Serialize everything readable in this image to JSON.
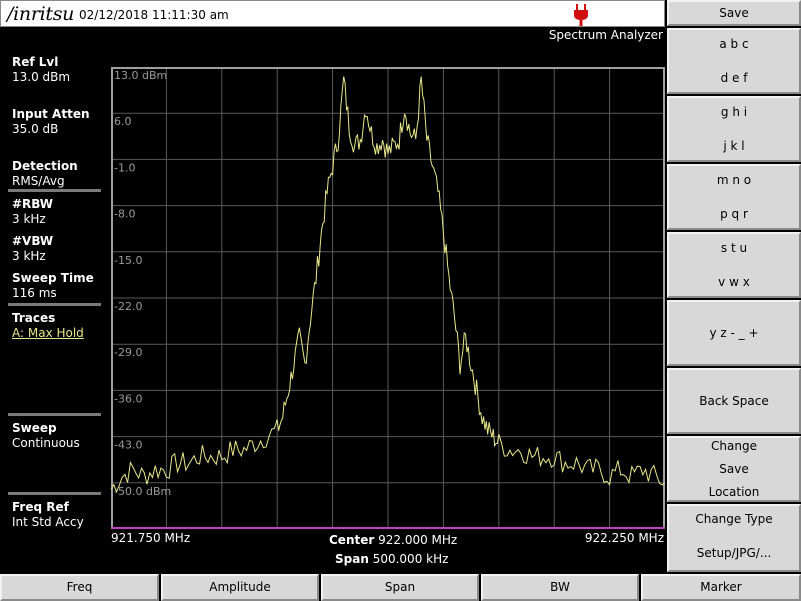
{
  "header": {
    "logo": "/inritsu",
    "datetime": "02/12/2018 11:11:30 am",
    "mode": "Spectrum Analyzer"
  },
  "left_panel": {
    "ref_lvl_label": "Ref Lvl",
    "ref_lvl_value": "13.0 dBm",
    "input_atten_label": "Input Atten",
    "input_atten_value": "35.0 dB",
    "detection_label": "Detection",
    "detection_value": "RMS/Avg",
    "rbw_label": "#RBW",
    "rbw_value": "3 kHz",
    "vbw_label": "#VBW",
    "vbw_value": "3 kHz",
    "sweep_time_label": "Sweep Time",
    "sweep_time_value": "116 ms",
    "traces_label": "Traces",
    "traces_value": "A: Max Hold",
    "sweep_label": "Sweep",
    "sweep_value": "Continuous",
    "freq_ref_label": "Freq Ref",
    "freq_ref_value": "Int Std Accy"
  },
  "graph": {
    "y_labels": [
      "13.0 dBm",
      "6.0",
      "-1.0",
      "-8.0",
      "-15.0",
      "-22.0",
      "-29.0",
      "-36.0",
      "-43.0",
      "-50.0 dBm"
    ],
    "x_start": "921.750 MHz",
    "x_end": "922.250 MHz",
    "center_label": "Center",
    "center_value": "922.000 MHz",
    "span_label": "Span",
    "span_value": "500.000 kHz",
    "colors": {
      "trace": "#e8e88a",
      "grid": "#5a5a5a",
      "frame": "#a0a0a0",
      "bottom_line": "#c040c0"
    }
  },
  "chart_data": {
    "type": "line",
    "title": "",
    "xlabel": "",
    "ylabel": "",
    "xlim": [
      921.75,
      922.25
    ],
    "ylim": [
      -57.0,
      13.0
    ],
    "x_unit": "MHz",
    "y_unit": "dBm",
    "grid": true,
    "series": [
      {
        "x": [
          921.75,
          921.76,
          921.77,
          921.78,
          921.79,
          921.8,
          921.81,
          921.82,
          921.83,
          921.84,
          921.85,
          921.86,
          921.87,
          921.88,
          921.89,
          921.9,
          921.905,
          921.91,
          921.915,
          921.92,
          921.925,
          921.93,
          921.935,
          921.94,
          921.945,
          921.95,
          921.955,
          921.96,
          921.965,
          921.97,
          921.975,
          921.98,
          921.985,
          921.99,
          921.995,
          922.0,
          922.005,
          922.01,
          922.015,
          922.02,
          922.025,
          922.03,
          922.035,
          922.04,
          922.045,
          922.05,
          922.055,
          922.06,
          922.065,
          922.07,
          922.075,
          922.08,
          922.085,
          922.09,
          922.095,
          922.1,
          922.11,
          922.12,
          922.13,
          922.14,
          922.15,
          922.16,
          922.17,
          922.18,
          922.19,
          922.2,
          922.21,
          922.22,
          922.23,
          922.24,
          922.25
        ],
        "y": [
          -51,
          -49,
          -48,
          -49,
          -48,
          -48,
          -47,
          -47,
          -46,
          -46,
          -46,
          -45,
          -45,
          -44,
          -43,
          -42,
          -40,
          -36,
          -32,
          -28,
          -32,
          -25,
          -19,
          -12,
          -6,
          -2,
          2,
          11,
          4,
          1,
          2,
          7,
          3,
          1,
          2,
          0,
          1,
          2,
          7,
          3,
          2,
          11,
          2,
          -2,
          -6,
          -12,
          -19,
          -25,
          -32,
          -28,
          -32,
          -36,
          -40,
          -42,
          -43,
          -44,
          -45,
          -45,
          -46,
          -46,
          -46,
          -47,
          -47,
          -48,
          -48,
          -49,
          -48,
          -49,
          -48,
          -49,
          -50
        ]
      }
    ]
  },
  "softkeys": {
    "save": "Save",
    "k1_top": "a b c",
    "k1_bottom": "d e f",
    "k2_top": "g h i",
    "k2_bottom": "j k l",
    "k3_top": "m n o",
    "k3_bottom": "p q r",
    "k4_top": "s t u",
    "k4_bottom": "v w x",
    "k5": "y z - _ +",
    "k6": "Back Space",
    "k7_l1": "Change",
    "k7_l2": "Save",
    "k7_l3": "Location",
    "k8_top": "Change Type",
    "k8_bottom": "Setup/JPG/..."
  },
  "bottom_keys": {
    "freq": "Freq",
    "amplitude": "Amplitude",
    "span": "Span",
    "bw": "BW",
    "marker": "Marker"
  }
}
